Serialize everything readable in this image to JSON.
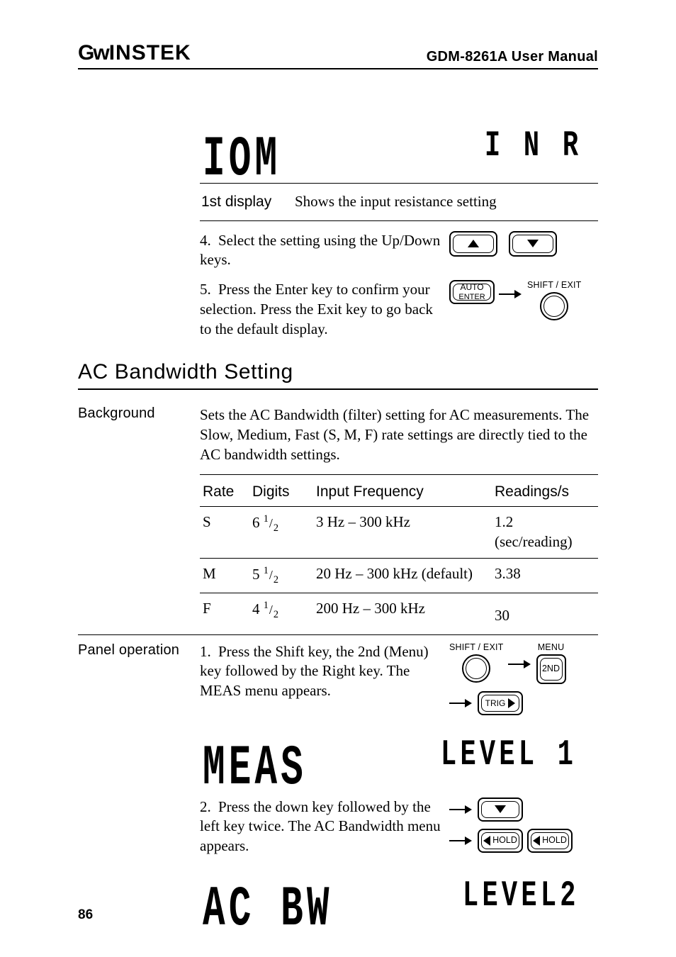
{
  "header": {
    "brand_prefix": "G",
    "brand_mid": "ᴡ",
    "brand_rest": "INSTEK",
    "doc_title": "GDM-8261A User Manual"
  },
  "top_display": {
    "primary_seg": "IOM",
    "secondary_seg": "I N  R"
  },
  "first_display_row": {
    "label": "1st display",
    "desc": "Shows the input resistance setting"
  },
  "steps_top": [
    {
      "num": "4.",
      "text": "Select the setting using the Up/Down keys.",
      "keys": [
        {
          "name": "up-key",
          "kind": "rect tri-up"
        },
        {
          "name": "down-key",
          "kind": "rect tri-down"
        }
      ]
    },
    {
      "num": "5.",
      "text": "Press the Enter key to confirm your selection. Press the Exit key to go back to the default display.",
      "keys": [
        {
          "name": "auto-enter-key",
          "kind": "auto",
          "line1": "AUTO",
          "line2": "ENTER",
          "over": ""
        },
        {
          "name": "arrow",
          "kind": "arrow"
        },
        {
          "name": "shift-exit-key",
          "kind": "circle",
          "over": "SHIFT / EXIT"
        }
      ]
    }
  ],
  "section_heading": "AC Bandwidth Setting",
  "bg_label": "Background",
  "bg_text": "Sets the AC Bandwidth (filter) setting for AC measurements. The Slow, Medium, Fast (S, M, F) rate settings are directly tied to the AC bandwidth settings.",
  "bw_table": {
    "headers": [
      "Rate",
      "Digits",
      "Input Frequency",
      "Readings/s"
    ],
    "rows": [
      {
        "rate": "S",
        "digits_int": "6",
        "freq": "3 Hz – 300 kHz",
        "rs_line1": "1.2",
        "rs_line2": "(sec/reading)"
      },
      {
        "rate": "M",
        "digits_int": "5",
        "freq": "20 Hz – 300 kHz (default)",
        "rs_line1": "3.38",
        "rs_line2": ""
      },
      {
        "rate": "F",
        "digits_int": "4",
        "freq": "200 Hz – 300 kHz",
        "rs_line1": "30",
        "rs_line2": ""
      }
    ]
  },
  "panel_label": "Panel operation",
  "panel_steps": [
    {
      "num": "1.",
      "text": "Press the Shift key, the 2nd (Menu) key followed by the Right key. The MEAS menu appears.",
      "display_primary": "MEAS",
      "display_secondary": "LEVEL 1",
      "keys": {
        "over_shift": "SHIFT / EXIT",
        "over_menu": "MENU",
        "menu_label": "2ND",
        "trig_label": "TRIG"
      }
    },
    {
      "num": "2.",
      "text": "Press the down key followed by the left key twice. The AC Bandwidth menu appears.",
      "display_primary": "AC  BW",
      "display_secondary": "LEVEL2",
      "hold_label": "HOLD"
    }
  ],
  "page_number": "86"
}
